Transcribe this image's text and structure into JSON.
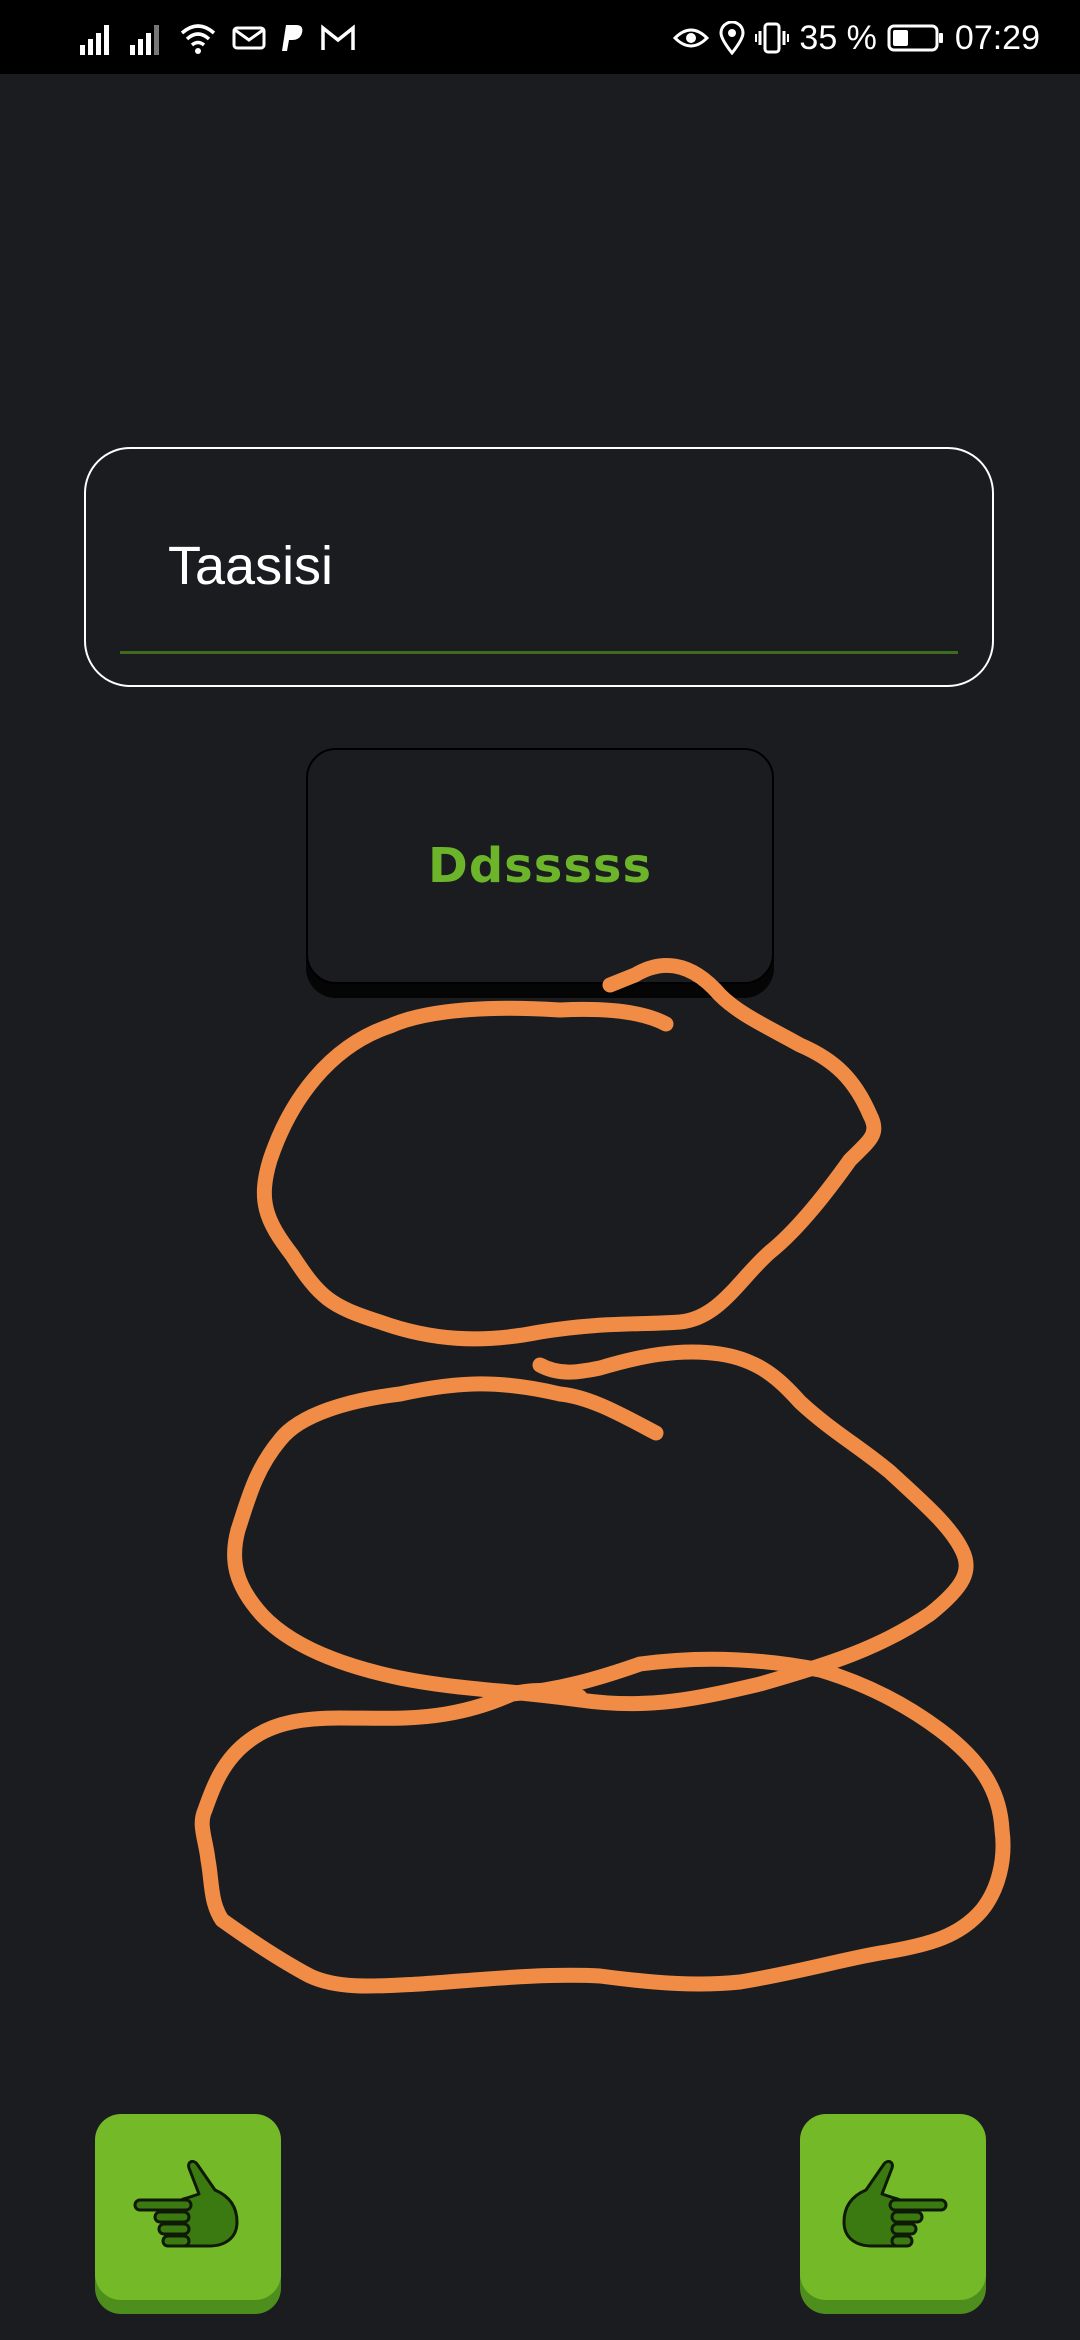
{
  "status_bar": {
    "battery_percent": "35 %",
    "time": "07:29",
    "icons": [
      "signal-icon",
      "signal-icon",
      "wifi-icon",
      "mail-icon",
      "paypal-icon",
      "gmail-icon",
      "eye-icon",
      "location-icon",
      "vibrate-icon",
      "battery-icon"
    ]
  },
  "text_field": {
    "value": "Taasisi",
    "underline_color": "#3e6b1e"
  },
  "main_button": {
    "label": "Ddsssss",
    "label_color": "#6cb52a"
  },
  "drawing": {
    "stroke_color": "#f08c45"
  },
  "nav": {
    "prev_icon": "hand-pointing-left-icon",
    "next_icon": "hand-pointing-right-icon",
    "button_color": "#74b928"
  }
}
